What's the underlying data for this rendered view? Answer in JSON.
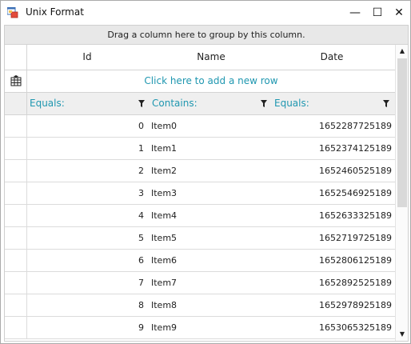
{
  "window": {
    "title": "Unix Format",
    "minimize_glyph": "—",
    "maximize_glyph": "☐",
    "close_glyph": "✕"
  },
  "grid": {
    "group_panel_text": "Drag a column here to group by this column.",
    "columns": [
      {
        "label": "Id"
      },
      {
        "label": "Name"
      },
      {
        "label": "Date"
      }
    ],
    "new_row_text": "Click here to add a new row",
    "filters": [
      {
        "label": "Equals:"
      },
      {
        "label": "Contains:"
      },
      {
        "label": "Equals:"
      }
    ],
    "rows": [
      {
        "id": "0",
        "name": "Item0",
        "date": "1652287725189"
      },
      {
        "id": "1",
        "name": "Item1",
        "date": "1652374125189"
      },
      {
        "id": "2",
        "name": "Item2",
        "date": "1652460525189"
      },
      {
        "id": "3",
        "name": "Item3",
        "date": "1652546925189"
      },
      {
        "id": "4",
        "name": "Item4",
        "date": "1652633325189"
      },
      {
        "id": "5",
        "name": "Item5",
        "date": "1652719725189"
      },
      {
        "id": "6",
        "name": "Item6",
        "date": "1652806125189"
      },
      {
        "id": "7",
        "name": "Item7",
        "date": "1652892525189"
      },
      {
        "id": "8",
        "name": "Item8",
        "date": "1652978925189"
      },
      {
        "id": "9",
        "name": "Item9",
        "date": "1653065325189"
      }
    ],
    "scroll_up_glyph": "▲",
    "scroll_down_glyph": "▼"
  },
  "colors": {
    "accent": "#1f97b0",
    "group_panel_bg": "#e8e8e8",
    "filter_bg": "#efefef"
  },
  "icons": {
    "app": "app-window-icon",
    "new_row": "table-add-row-icon",
    "filter": "filter-funnel-icon"
  }
}
